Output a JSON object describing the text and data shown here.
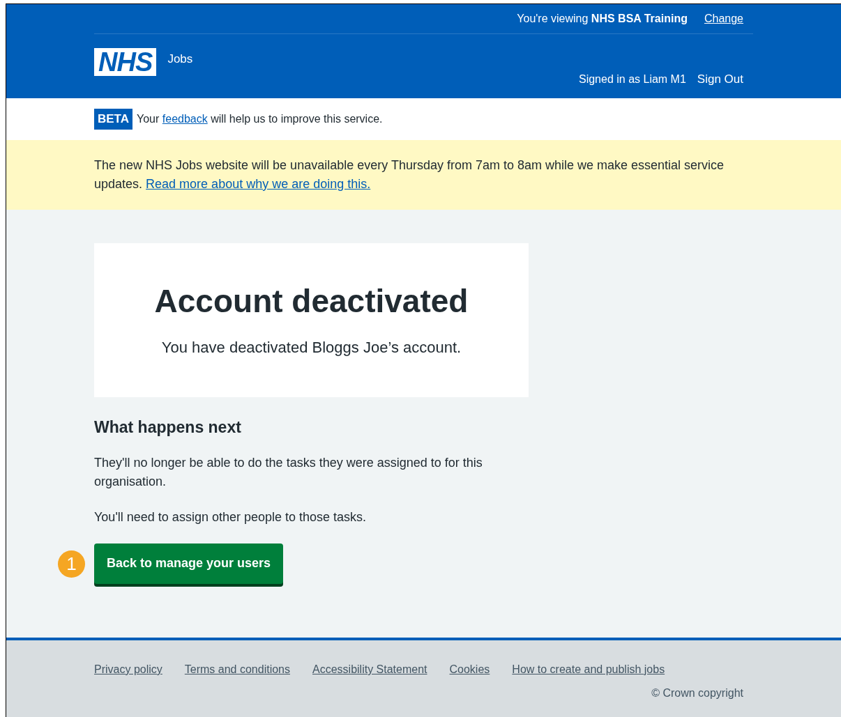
{
  "header": {
    "viewing_prefix": "You're viewing",
    "organisation": "NHS BSA Training",
    "change_link": "Change",
    "logo_text": "NHS",
    "service_name": "Jobs",
    "signed_in": "Signed in as Liam M1",
    "sign_out": "Sign Out"
  },
  "beta_banner": {
    "tag": "BETA",
    "text_before": "Your",
    "link": "feedback",
    "text_after": "will help us to improve this service."
  },
  "notice": {
    "text": "The new NHS Jobs website will be unavailable every Thursday from 7am to 8am while we make essential service updates.",
    "link": "Read more about why we are doing this."
  },
  "confirmation": {
    "title": "Account deactivated",
    "body": "You have deactivated Bloggs Joe’s account."
  },
  "next_steps": {
    "heading": "What happens next",
    "paragraphs": [
      "They'll no longer be able to do the tasks they were assigned to for this organisation.",
      "You'll need to assign other people to those tasks."
    ]
  },
  "callout": "1",
  "primary_button": "Back to manage your users",
  "footer": {
    "links": [
      "Privacy policy",
      "Terms and conditions",
      "Accessibility Statement",
      "Cookies",
      "How to create and publish jobs"
    ],
    "copyright": "© Crown copyright"
  }
}
